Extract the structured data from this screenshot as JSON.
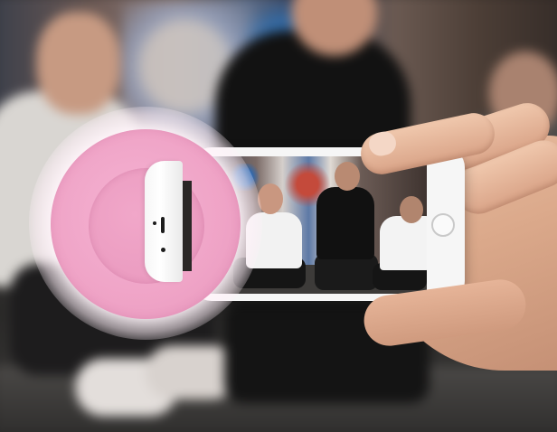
{
  "scene": {
    "subject": "pink-selfie-ring-light-clipped-on-phone",
    "colors": {
      "ring_pink": "#efa3c6",
      "phone_white": "#f6f6f6",
      "glow": "#fff5fa"
    },
    "icons": [
      "ring-light-icon",
      "phone-home-button-icon"
    ]
  }
}
